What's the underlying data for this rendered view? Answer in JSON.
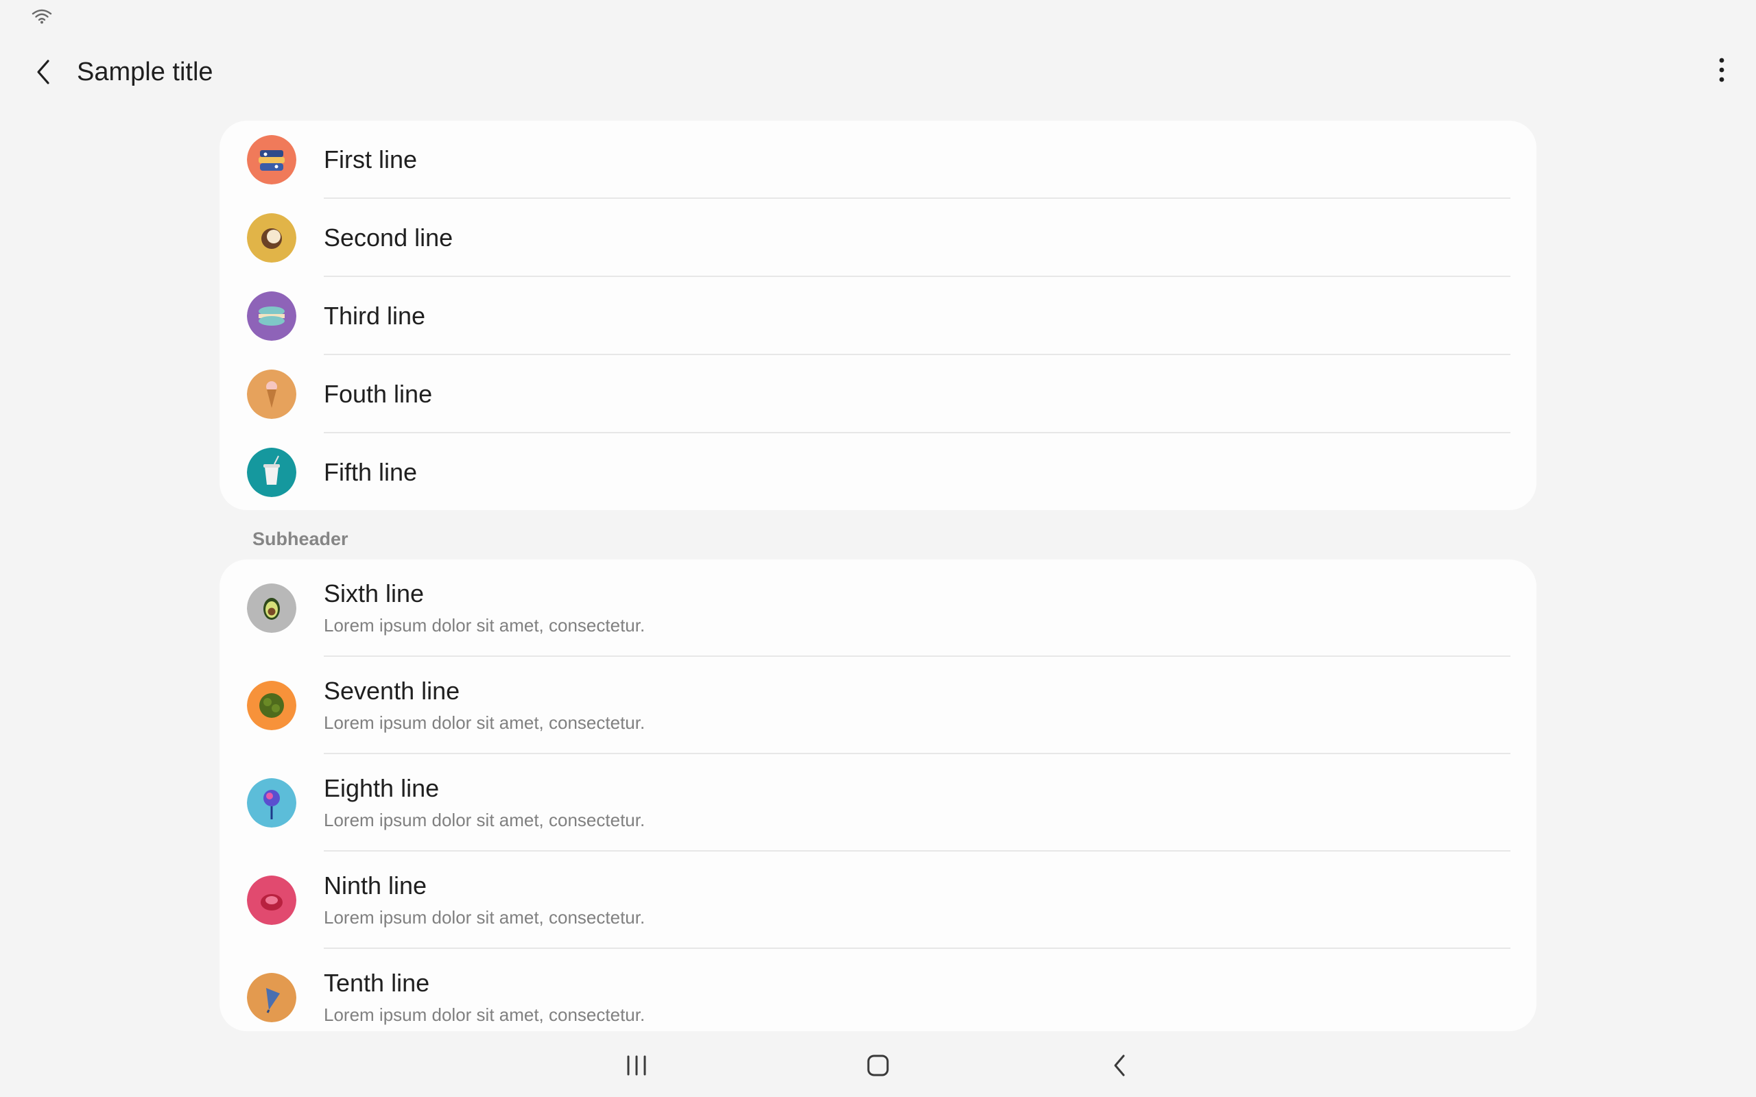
{
  "header": {
    "title": "Sample title"
  },
  "icons": {
    "back": "chevron-left-icon",
    "more": "more-vertical-icon",
    "wifi": "wifi-icon"
  },
  "list1": {
    "items": [
      {
        "label": "First line",
        "avatar_color": "#f07a5a",
        "icon": "sandwich-icon"
      },
      {
        "label": "Second line",
        "avatar_color": "#e1b448",
        "icon": "coconut-icon"
      },
      {
        "label": "Third line",
        "avatar_color": "#8e63b8",
        "icon": "macaron-icon"
      },
      {
        "label": "Fouth line",
        "avatar_color": "#e6a25c",
        "icon": "ice-cream-icon"
      },
      {
        "label": "Fifth line",
        "avatar_color": "#15989e",
        "icon": "cup-icon"
      }
    ]
  },
  "subheader": "Subheader",
  "list2": {
    "items": [
      {
        "label": "Sixth line",
        "subtitle": "Lorem ipsum dolor sit amet, consectetur.",
        "avatar_color": "#b8b8b8",
        "icon": "avocado-icon"
      },
      {
        "label": "Seventh line",
        "subtitle": "Lorem ipsum dolor sit amet, consectetur.",
        "avatar_color": "#f7923a",
        "icon": "broccoli-icon"
      },
      {
        "label": "Eighth line",
        "subtitle": "Lorem ipsum dolor sit amet, consectetur.",
        "avatar_color": "#5cbdd9",
        "icon": "lollipop-icon"
      },
      {
        "label": "Ninth line",
        "subtitle": "Lorem ipsum dolor sit amet, consectetur.",
        "avatar_color": "#e14a6f",
        "icon": "candy-icon"
      },
      {
        "label": "Tenth line",
        "subtitle": "Lorem ipsum dolor sit amet, consectetur.",
        "avatar_color": "#e39a4f",
        "icon": "cone-icon"
      }
    ]
  },
  "nav": {
    "recents": "recents-icon",
    "home": "home-icon",
    "back": "back-icon"
  }
}
